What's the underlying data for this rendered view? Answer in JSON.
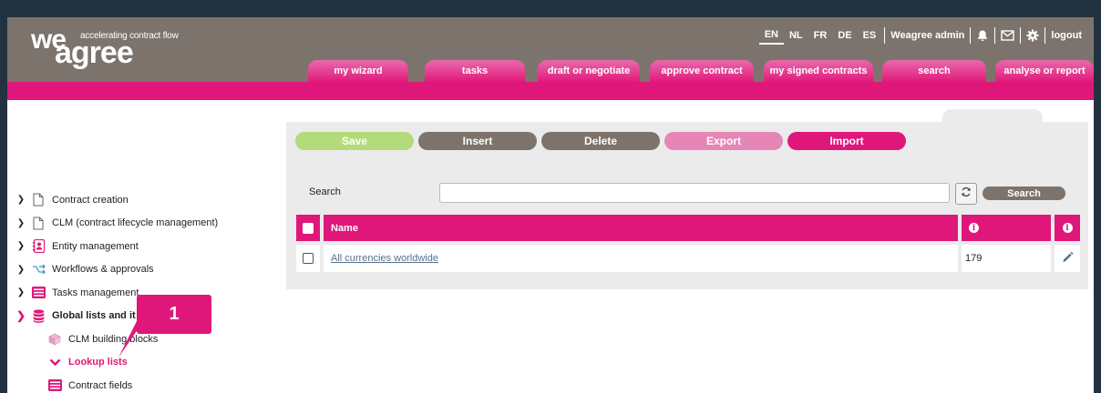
{
  "brand": {
    "logo_we": "we",
    "logo_agree": "agree",
    "tagline": "accelerating contract flow"
  },
  "header": {
    "languages": [
      "EN",
      "NL",
      "FR",
      "DE",
      "ES"
    ],
    "active_language": "EN",
    "user": "Weagree admin",
    "logout": "logout",
    "icons": [
      "bell-icon",
      "mail-icon",
      "gear-icon"
    ]
  },
  "nav": {
    "tabs": [
      {
        "label": "my wizard"
      },
      {
        "label": "tasks"
      },
      {
        "label": "draft or negotiate"
      },
      {
        "label": "approve contract"
      },
      {
        "label": "my signed contracts"
      },
      {
        "label": "search"
      },
      {
        "label": "analyse or report"
      }
    ]
  },
  "sidebar": {
    "items": [
      {
        "label": "Contract creation",
        "icon": "document-icon",
        "expanded": false
      },
      {
        "label": "CLM (contract lifecycle management)",
        "icon": "document-icon",
        "expanded": false
      },
      {
        "label": "Entity management",
        "icon": "contact-card-icon",
        "expanded": false
      },
      {
        "label": "Workflows & approvals",
        "icon": "workflow-icon",
        "expanded": false
      },
      {
        "label": "Tasks management",
        "icon": "list-icon",
        "expanded": false
      },
      {
        "label": "Global lists and it",
        "icon": "database-icon",
        "expanded": true
      }
    ],
    "subitems": [
      {
        "label": "CLM building blocks",
        "icon": "blocks-icon"
      },
      {
        "label": "Lookup lists",
        "icon": "chevron-down-icon"
      },
      {
        "label": "Contract fields",
        "icon": "list-icon"
      }
    ]
  },
  "toolbar": {
    "save": "Save",
    "insert": "Insert",
    "delete": "Delete",
    "export": "Export",
    "import": "Import"
  },
  "search": {
    "label": "Search",
    "placeholder": "",
    "value": "",
    "button": "Search"
  },
  "table": {
    "header_name": "Name",
    "rows": [
      {
        "name": "All currencies worldwide",
        "count": "179"
      }
    ]
  },
  "callout": {
    "number": "1"
  },
  "colors": {
    "brand_pink": "#e0177a",
    "header_taupe": "#7c746c",
    "save_green": "#b3db7a",
    "export_pink_light": "#e586b6"
  }
}
